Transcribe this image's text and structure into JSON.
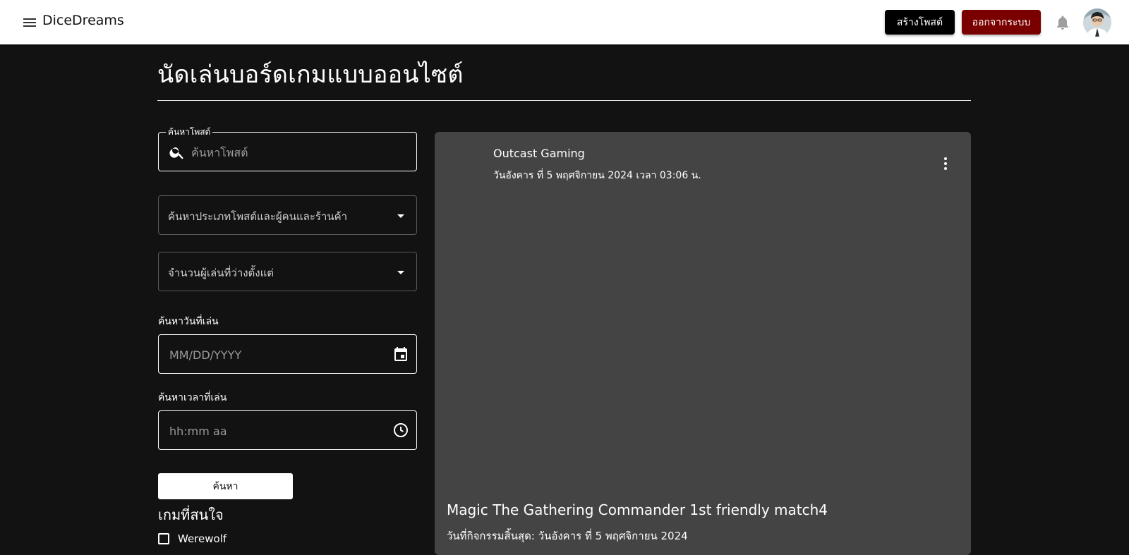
{
  "header": {
    "brand": "DiceDreams",
    "create_post_label": "สร้างโพสต์",
    "logout_label": "ออกจากระบบ"
  },
  "page": {
    "title": "นัดเล่นบอร์ดเกมแบบออนไซต์"
  },
  "filters": {
    "search_legend": "ค้นหาโพสต์",
    "search_placeholder": "ค้นหาโพสต์",
    "post_type_label": "ค้นหาประเภทโพสต์และผู้คนและร้านค้า",
    "players_label": "จำนวนผู้เล่นที่ว่างตั้งแต่",
    "date_label": "ค้นหาวันที่เล่น",
    "date_placeholder": "MM/DD/YYYY",
    "time_label": "ค้นหาเวลาที่เล่น",
    "time_placeholder": "hh:mm aa",
    "search_button": "ค้นหา",
    "interests_title": "เกมที่สนใจ",
    "interests": [
      "Werewolf"
    ]
  },
  "post": {
    "author": "Outcast Gaming",
    "date": "วันอังคาร ที่ 5 พฤศจิกายน 2024 เวลา 03:06 น.",
    "title": "Magic The Gathering Commander 1st friendly match4",
    "end_date": "วันที่กิจกรรมสิ้นสุด: วันอังคาร ที่ 5 พฤศจิกายน 2024"
  },
  "icons": {
    "menu": "menu-icon",
    "bell": "bell-icon",
    "search": "search-icon",
    "dropdown": "arrow-drop-down-icon",
    "calendar": "calendar-icon",
    "clock": "clock-icon",
    "more": "more-vert-icon"
  },
  "colors": {
    "background": "#121212",
    "appbar": "#ffffff",
    "create_button": "#000000",
    "logout_button": "#7a0000",
    "card": "#444444"
  }
}
